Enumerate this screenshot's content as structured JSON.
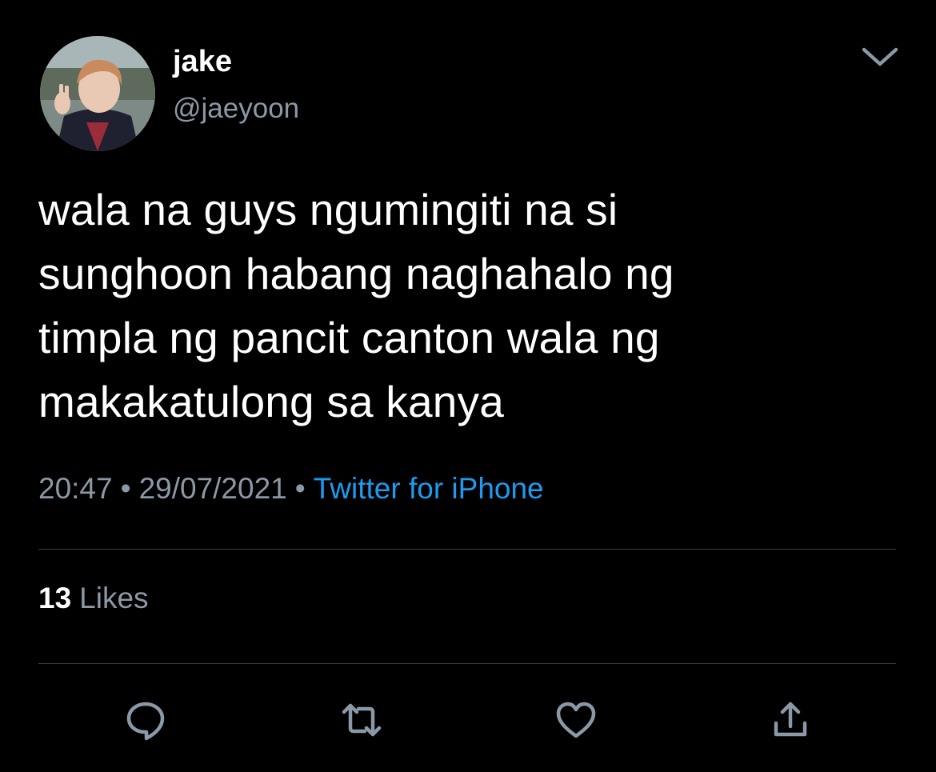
{
  "tweet": {
    "display_name": "jake",
    "handle": "@jaeyoon",
    "text": "wala na guys ngumingiti na si\nsunghoon habang naghahalo ng\ntimpla ng pancit canton wala ng\nmakakatulong sa kanya",
    "time": "20:47",
    "separator": "•",
    "date": "29/07/2021",
    "source": "Twitter for iPhone"
  },
  "stats": {
    "likes_count": "13",
    "likes_label": "Likes"
  },
  "icons": {
    "caret": "chevron-down-icon",
    "reply": "reply-icon",
    "retweet": "retweet-icon",
    "like": "heart-icon",
    "share": "share-icon"
  },
  "colors": {
    "background": "#000000",
    "text": "#ffffff",
    "secondary": "#8b98a5",
    "link": "#1d9bf0",
    "divider": "#3a3f44"
  }
}
